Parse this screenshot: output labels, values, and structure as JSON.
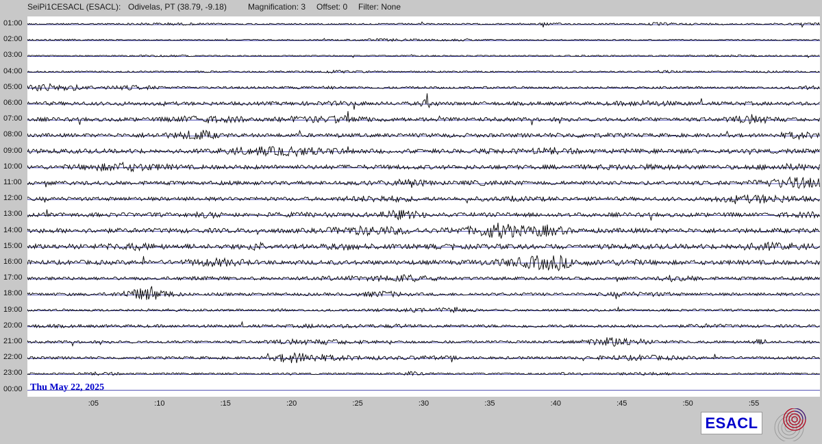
{
  "header": {
    "station": "SeiPi1CESACL (ESACL):",
    "location": "Odivelas, PT (38.79, -9.18)",
    "magnification": "Magnification: 3",
    "offset": "Offset: 0",
    "filter": "Filter: None"
  },
  "hours": [
    "01:00",
    "02:00",
    "03:00",
    "04:00",
    "05:00",
    "06:00",
    "07:00",
    "08:00",
    "09:00",
    "10:00",
    "11:00",
    "12:00",
    "13:00",
    "14:00",
    "15:00",
    "16:00",
    "17:00",
    "18:00",
    "19:00",
    "20:00",
    "21:00",
    "22:00",
    "23:00",
    "00:00"
  ],
  "minute_ticks": [
    ":05",
    ":10",
    ":15",
    ":20",
    ":25",
    ":30",
    ":35",
    ":40",
    ":45",
    ":50",
    ":55"
  ],
  "date": "Thu May 22, 2025",
  "brand": "ESACL",
  "colors": {
    "trace": "#000000",
    "baseline": "#1a1a9e",
    "date": "#0000cc",
    "background": "#c8c8c8"
  },
  "icons": {
    "logo": "concentric-circles-logo-icon"
  },
  "chart_data": {
    "type": "helicorder",
    "rows": 24,
    "minutes_per_row": 60,
    "trace_amplitude_levels": [
      1.0,
      0.8,
      0.9,
      1.1,
      1.6,
      2.6,
      2.8,
      2.6,
      3.2,
      3.1,
      2.8,
      2.7,
      3.0,
      3.4,
      3.6,
      3.2,
      2.3,
      2.1,
      1.6,
      2.1,
      1.9,
      1.9,
      1.3,
      0
    ]
  }
}
